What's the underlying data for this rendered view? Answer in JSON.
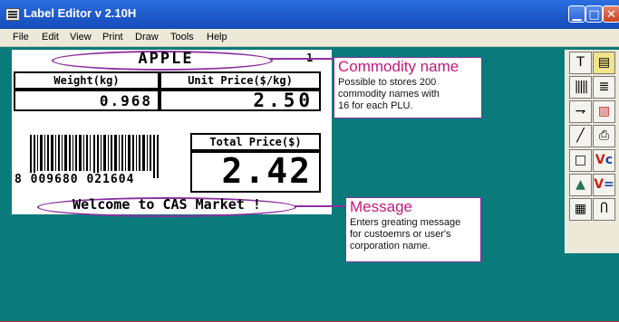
{
  "window": {
    "title": "Label Editor v 2.10H"
  },
  "menu": [
    "File",
    "Edit",
    "View",
    "Print",
    "Draw",
    "Tools",
    "Help"
  ],
  "label": {
    "commodity": "APPLE",
    "plu_number": "1",
    "weight_header": "Weight(kg)",
    "unit_price_header": "Unit Price($/kg)",
    "weight_value": "0.968",
    "unit_price_value": "2.50",
    "total_price_header": "Total Price($)",
    "total_price_value": "2.42",
    "barcode_digits": "8 009680 021604",
    "message": "Welcome to CAS Market !"
  },
  "callouts": {
    "commodity": {
      "title": "Commodity name",
      "desc": [
        "Possible to stores 200",
        "commodity names with",
        "16 for each PLU."
      ]
    },
    "message": {
      "title": "Message",
      "desc": [
        "Enters greating message",
        "for custoemrs or user's",
        "corporation name."
      ]
    }
  },
  "toolbox": {
    "tools": [
      "text-tool",
      "field-tool",
      "barcode-tool",
      "list-tool",
      "line-arrow-tool",
      "image-tool",
      "line-tool",
      "print-tool",
      "rectangle-tool",
      "variable-c-tool",
      "picture-tool",
      "variable-equals-tool",
      "layout-tool",
      "clamp-tool"
    ]
  },
  "colors": {
    "accent": "#8b2fa0",
    "callout_title": "#c2187a",
    "background": "#0a7a7a"
  }
}
